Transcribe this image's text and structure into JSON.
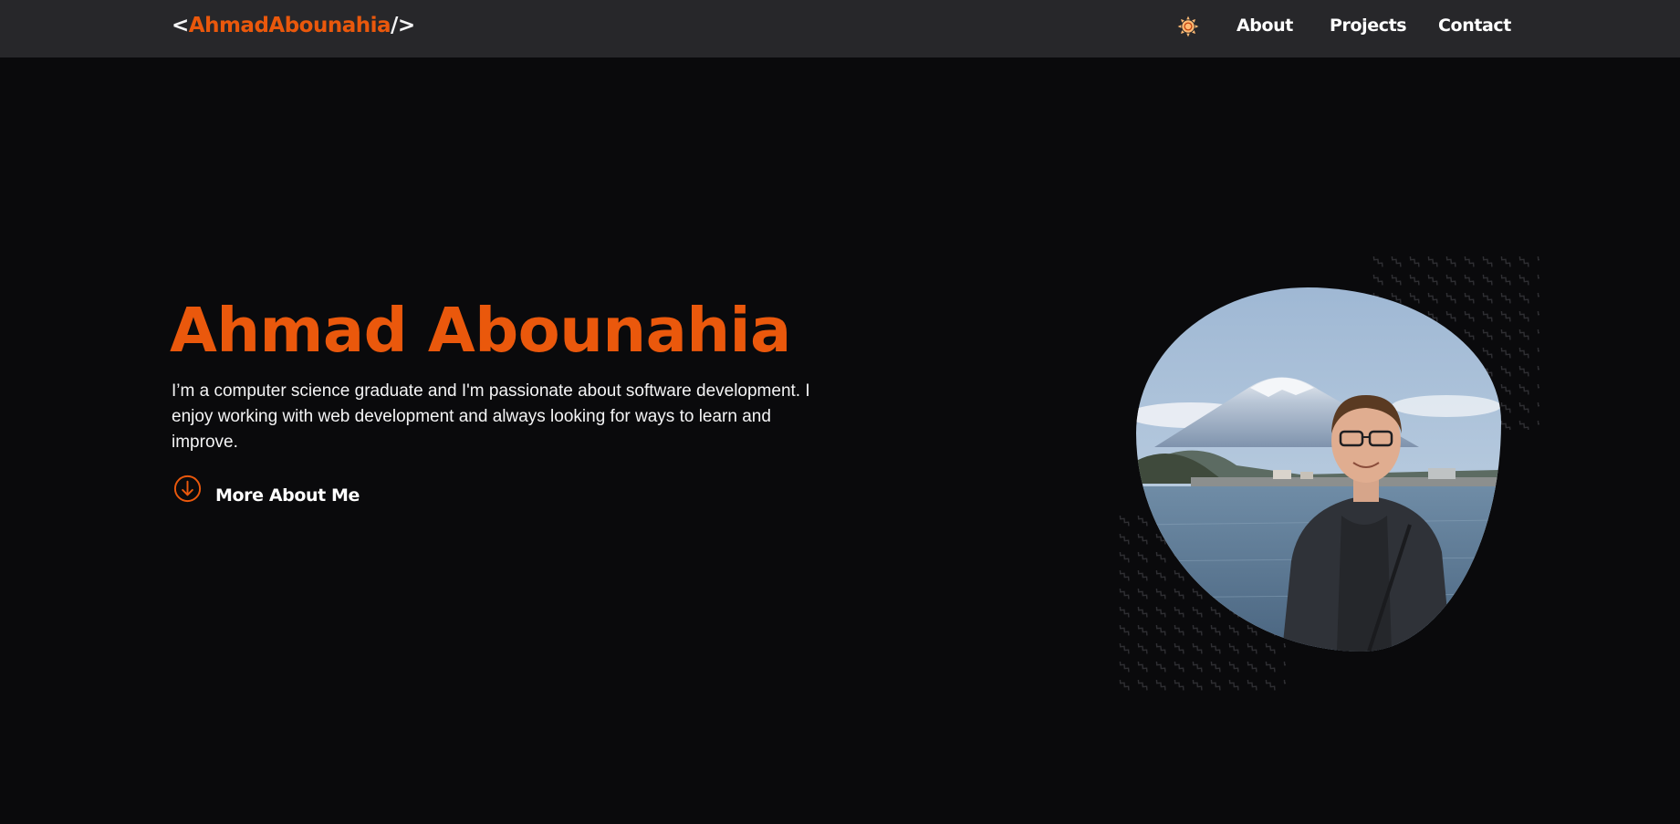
{
  "nav": {
    "logo": {
      "open_bracket": "<",
      "name": "AhmadAbounahia",
      "close_bracket": "/>"
    },
    "theme_toggle_icon": "sun-icon",
    "links": {
      "about": "About",
      "projects": "Projects",
      "contact": "Contact"
    }
  },
  "hero": {
    "title": "Ahmad Abounahia",
    "description": "I’m a computer science graduate and I'm passionate about software development. I enjoy working with web development and always looking for ways to learn and improve.",
    "more_button": {
      "label": "More About Me",
      "icon": "arrow-down-circle-icon"
    },
    "photo": {
      "subject": "portrait",
      "alt": "Ahmad Abounahia in front of Mount Fuji and a lake"
    }
  },
  "colors": {
    "accent": "#ea580c",
    "nav_background": "#27272a",
    "page_background": "#0a0a0c",
    "text": "#ffffff",
    "sun_icon": "#fdba74"
  }
}
